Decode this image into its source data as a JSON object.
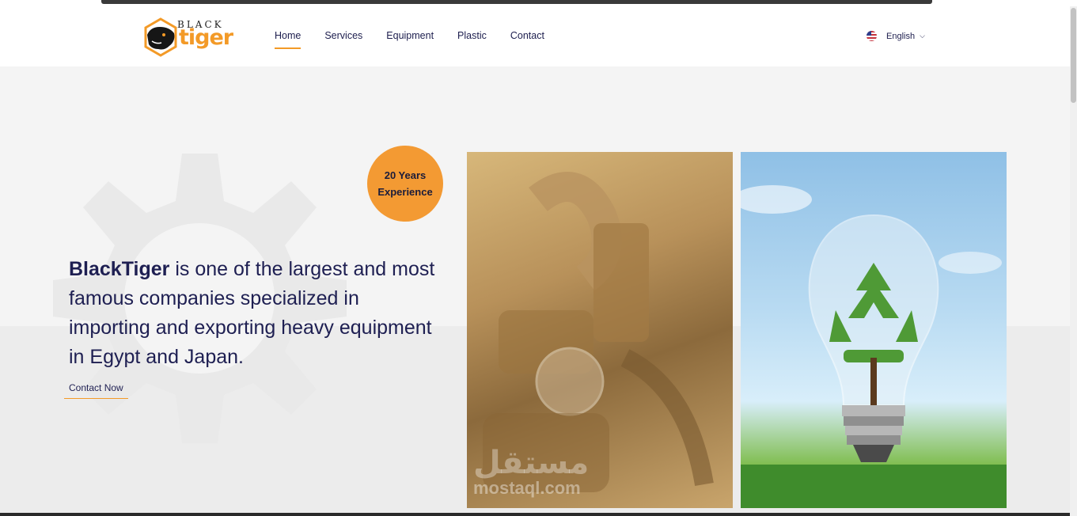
{
  "brand": {
    "logo_top": "BLACK",
    "logo_bottom": "tiger",
    "accent": "#f39a27"
  },
  "nav": {
    "items": [
      {
        "label": "Home",
        "active": true
      },
      {
        "label": "Services"
      },
      {
        "label": "Equipment"
      },
      {
        "label": "Plastic"
      },
      {
        "label": "Contact"
      }
    ]
  },
  "language": {
    "label": "English",
    "flag_icon": "us-flag-icon",
    "chevron_icon": "chevron-down-icon"
  },
  "hero": {
    "badge_line1": "20 Years",
    "badge_line2": "Experience",
    "brand_name": "BlackTiger",
    "headline_rest": " is one of the largest and most famous companies specialized in importing and exporting heavy equipment in Egypt and Japan.",
    "cta_label": "Contact Now"
  },
  "images": {
    "engine_icon": "engine-photo",
    "bulb_icon": "recycle-bulb-photo"
  },
  "watermark": {
    "arabic": "مستقل",
    "latin": "mostaql.com"
  }
}
